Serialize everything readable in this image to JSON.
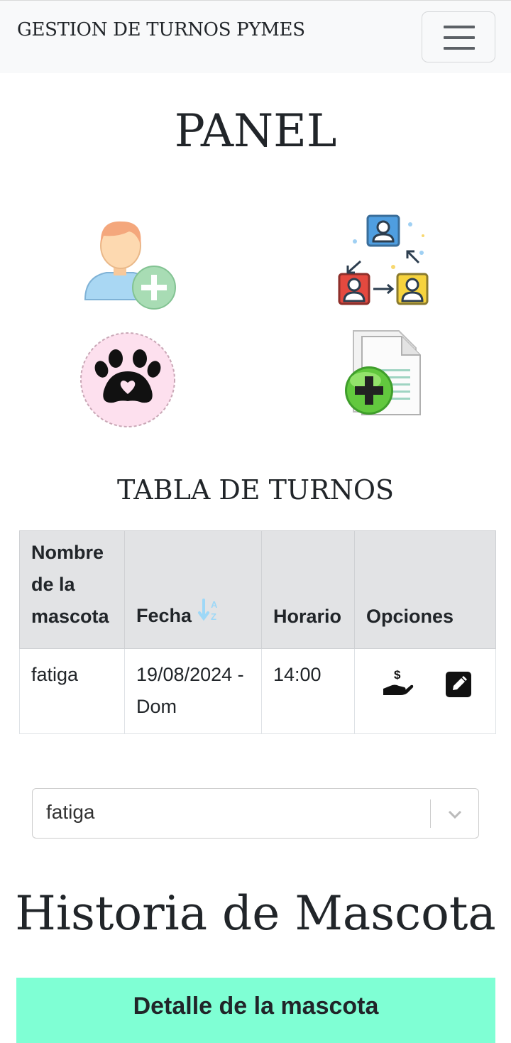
{
  "navbar": {
    "brand": "GESTION DE TURNOS PYMES",
    "menu_icon": "hamburger-menu-icon"
  },
  "panel": {
    "title": "PANEL",
    "tiles": [
      {
        "name": "add-user-icon"
      },
      {
        "name": "transfer-users-icon"
      },
      {
        "name": "pet-paw-icon"
      },
      {
        "name": "add-document-icon"
      }
    ]
  },
  "table": {
    "title": "TABLA DE TURNOS",
    "headers": [
      "Nombre de la mascota",
      "Fecha",
      "Horario",
      "Opciones"
    ],
    "sort_icon": "sort-alpha-down-icon",
    "rows": [
      {
        "nombre": "fatiga",
        "fecha": "19/08/2024 - Dom",
        "horario": "14:00",
        "actions": [
          "payment-icon",
          "edit-icon"
        ]
      }
    ]
  },
  "mascota_select": {
    "selected": "fatiga"
  },
  "historia": {
    "title": "Historia de Mascota",
    "detalle_label": "Detalle de la mascota"
  },
  "colors": {
    "navbar_bg": "#f8f9fa",
    "table_header_bg": "#e2e3e5",
    "detalle_bg": "#7fffd4",
    "sort_icon": "#9ed8f7"
  }
}
